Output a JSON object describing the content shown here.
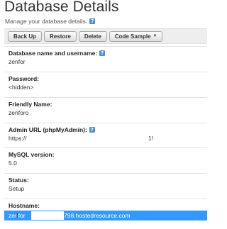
{
  "header": {
    "title": "Database Details",
    "subtitle": "Manage your database details."
  },
  "toolbar": {
    "backup_label": "Back Up",
    "restore_label": "Restore",
    "delete_label": "Delete",
    "code_sample_label": "Code Sample"
  },
  "fields": {
    "db_name": {
      "label": "Database name and username:",
      "value": "zenfor"
    },
    "password": {
      "label": "Password:",
      "value": "<hidden>"
    },
    "friendly_name": {
      "label": "Friendly Name:",
      "value": "zenforo"
    },
    "admin_url": {
      "label": "Admin URL (phpMyAdmin):",
      "value_left": "https://",
      "value_right": "1!"
    },
    "mysql_version": {
      "label": "MySQL version:",
      "value": "5.0"
    },
    "status": {
      "label": "Status:",
      "value": "Setup"
    },
    "hostname": {
      "label": "Hostname:",
      "value_left": "zenfor",
      "value_right": "798.hostedresource.com"
    }
  },
  "icons": {
    "help": "help-icon",
    "caret": "caret-down-icon",
    "text_cursor": "text-cursor-icon"
  },
  "colors": {
    "selection": "#3399ff",
    "toolbar_bg": "#eeeeee",
    "help_icon": "#4a8fd4"
  }
}
